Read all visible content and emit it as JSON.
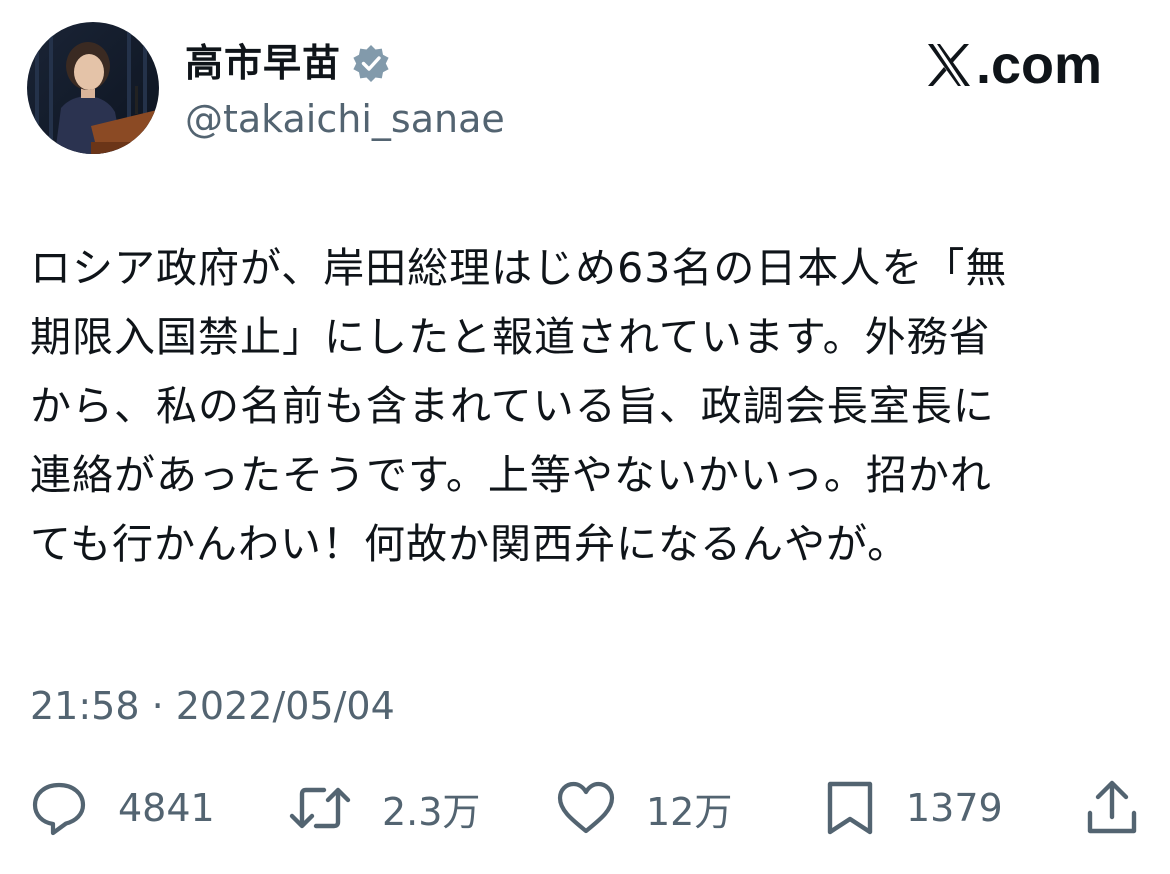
{
  "author": {
    "display_name": "高市早苗",
    "handle": "@takaichi_sanae",
    "verified": true,
    "verified_color": "#829aab"
  },
  "brand": {
    "label": ".com"
  },
  "tweet": {
    "text": "ロシア政府が、岸田総理はじめ63名の日本人を「無\n期限入国禁止」にしたと報道されています。外務省\nから、私の名前も含まれている旨、政調会長室長に\n連絡があったそうです。上等やないかいっ。招かれ\nても行かんわい！何故か関西弁になるんやが。",
    "timestamp": "21:58 · 2022/05/04"
  },
  "actions": {
    "reply": {
      "icon": "reply-icon",
      "count": "4841"
    },
    "retweet": {
      "icon": "retweet-icon",
      "count": "2.3万"
    },
    "like": {
      "icon": "heart-icon",
      "count": "12万"
    },
    "bookmark": {
      "icon": "bookmark-icon",
      "count": "1379"
    },
    "share": {
      "icon": "share-icon"
    }
  },
  "colors": {
    "text": "#0f1419",
    "secondary": "#536471",
    "background": "#ffffff"
  }
}
